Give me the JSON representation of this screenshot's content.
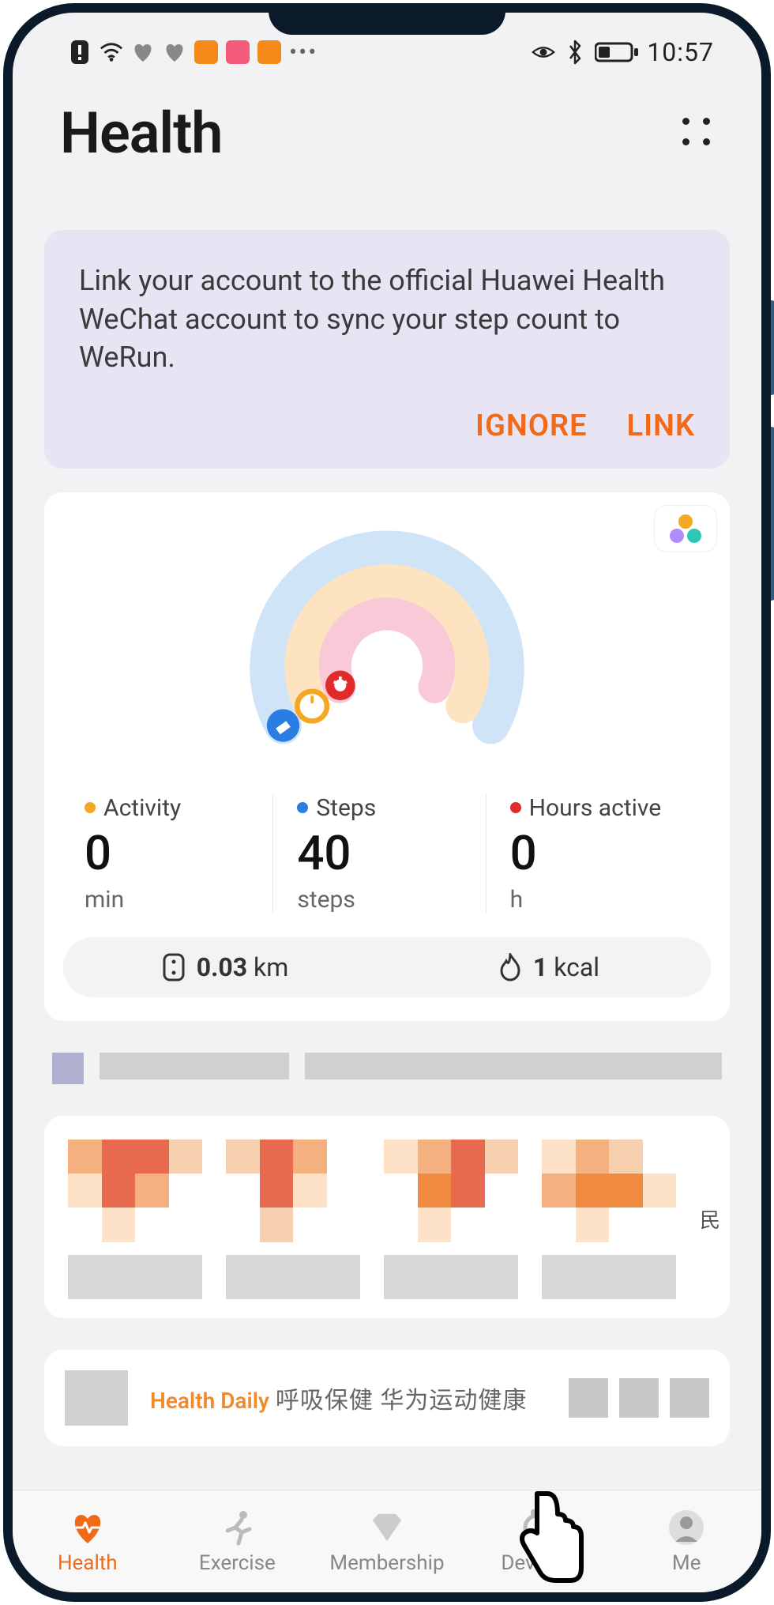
{
  "status": {
    "time": "10:57"
  },
  "header": {
    "title": "Health"
  },
  "banner": {
    "text": "Link your account to the official Huawei Health WeChat account to sync your step count to WeRun.",
    "ignore": "IGNORE",
    "link": "LINK"
  },
  "metrics": {
    "activity": {
      "label": "Activity",
      "value": "0",
      "unit": "min"
    },
    "steps": {
      "label": "Steps",
      "value": "40",
      "unit": "steps"
    },
    "hours": {
      "label": "Hours active",
      "value": "0",
      "unit": "h"
    }
  },
  "summary": {
    "distance_value": "0.03",
    "distance_unit": "km",
    "calories_value": "1",
    "calories_unit": "kcal"
  },
  "feed": {
    "pill": "Health Daily",
    "text": "呼吸保健 华为运动健康"
  },
  "nav": {
    "health": "Health",
    "exercise": "Exercise",
    "membership": "Membership",
    "devices": "Devices",
    "me": "Me"
  }
}
